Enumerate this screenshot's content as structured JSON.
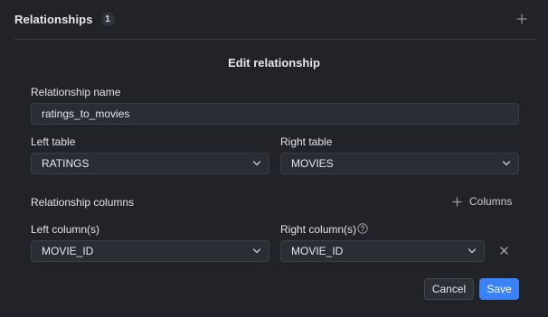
{
  "section": {
    "title": "Relationships",
    "count": "1",
    "add_icon": "plus-icon"
  },
  "editor": {
    "title": "Edit relationship",
    "relationship_name": {
      "label": "Relationship name",
      "value": "ratings_to_movies"
    },
    "left_table": {
      "label": "Left table",
      "value": "RATINGS"
    },
    "right_table": {
      "label": "Right table",
      "value": "MOVIES"
    },
    "relationship_columns": {
      "label": "Relationship columns",
      "add_label": "Columns"
    },
    "left_column": {
      "label": "Left column(s)",
      "value": "MOVIE_ID"
    },
    "right_column": {
      "label": "Right column(s)",
      "value": "MOVIE_ID",
      "help_icon": "question-circle-icon"
    },
    "actions": {
      "cancel": "Cancel",
      "save": "Save"
    }
  },
  "colors": {
    "background": "#212329",
    "field_bg": "#2a2d34",
    "field_border": "#3b3e47",
    "primary": "#3b82f6"
  }
}
